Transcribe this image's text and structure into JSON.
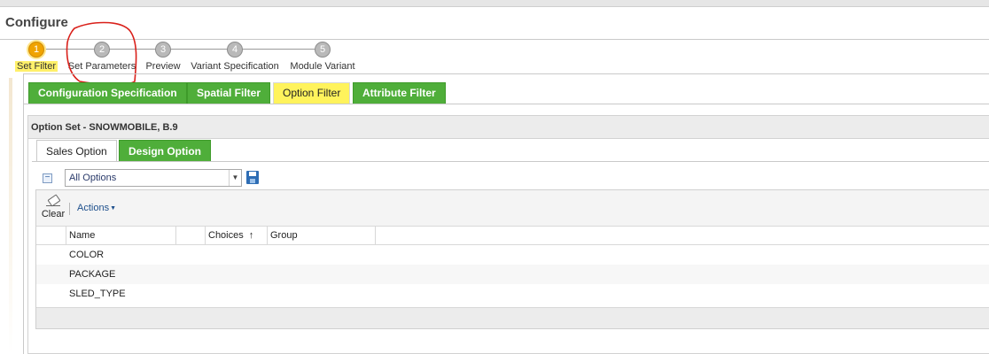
{
  "window": {
    "title": "Configure"
  },
  "wizard": {
    "steps": [
      {
        "number": "1",
        "label": "Set Filter"
      },
      {
        "number": "2",
        "label": "Set Parameters"
      },
      {
        "number": "3",
        "label": "Preview"
      },
      {
        "number": "4",
        "label": "Variant Specification"
      },
      {
        "number": "5",
        "label": "Module Variant"
      }
    ]
  },
  "filter_tabs": {
    "tabs": [
      {
        "label": "Configuration Specification"
      },
      {
        "label": "Spatial Filter"
      },
      {
        "label": "Option Filter"
      },
      {
        "label": "Attribute Filter"
      }
    ]
  },
  "option_set": {
    "title": "Option Set - SNOWMOBILE, B.9",
    "tabs": [
      {
        "label": "Sales Option"
      },
      {
        "label": "Design Option"
      }
    ],
    "view_select": {
      "value": "All Options"
    },
    "toolbar": {
      "clear_label": "Clear",
      "actions_label": "Actions"
    },
    "table": {
      "columns": [
        "Name",
        "",
        "Choices",
        "Group"
      ],
      "rows": [
        {
          "name": "COLOR"
        },
        {
          "name": "PACKAGE"
        },
        {
          "name": "SLED_TYPE"
        }
      ]
    }
  },
  "colors": {
    "tab_green": "#4fae3a",
    "highlight_yellow": "#fff35c",
    "active_step": "#f0a300",
    "annotation_red": "#d9201a"
  },
  "icons": [
    "collapse-icon",
    "dropdown-arrow-icon",
    "save-icon",
    "eraser-icon",
    "sort-ascending-icon"
  ]
}
